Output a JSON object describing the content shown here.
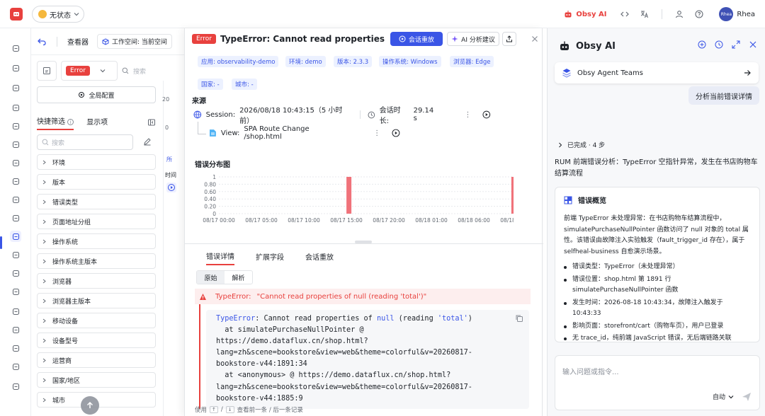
{
  "topbar": {
    "status_label": "无状态",
    "obsy_label": "Obsy AI",
    "user_avatar": "Rhea",
    "user_name": "Rhea"
  },
  "viewer": {
    "title": "查看器",
    "workspace": "工作空间: 当前空间",
    "filter_tag": "Error",
    "search_placeholder": "搜索",
    "global_config": "全局配置",
    "tab_quick_filter": "快捷筛选",
    "tab_display": "显示项",
    "facet_search_placeholder": "搜索",
    "facets": [
      "环境",
      "版本",
      "错误类型",
      "页面地址分组",
      "操作系统",
      "操作系统主版本",
      "浏览器",
      "浏览器主版本",
      "移动设备",
      "设备型号",
      "运营商",
      "国家/地区",
      "城市"
    ],
    "side_labels": [
      "20",
      "0",
      "所",
      "时间"
    ]
  },
  "detail": {
    "error_badge": "Error",
    "title": "TypeError: Cannot read properties of null...",
    "replay_button": "会话重放",
    "ai_button": "AI 分析建议",
    "tags": [
      "应用: observability-demo",
      "环境: demo",
      "版本: 2.3.3",
      "操作系统: Windows",
      "浏览器: Edge",
      "国家: -",
      "城市: -"
    ],
    "source_title": "来源",
    "session_label": "Session:",
    "session_time": "2026/08/18 10:43:15（5 小时前）",
    "duration_label": "会话时长:",
    "duration_value": "29.14 s",
    "view_label": "View:",
    "view_value": "SPA Route Change /shop.html",
    "dist_title": "错误分布图",
    "tabs": [
      "错误详情",
      "扩展字段",
      "会话重放"
    ],
    "toggle": [
      "原始",
      "解析"
    ],
    "error_type": "TypeError:",
    "error_message": "\"Cannot read properties of null (reading 'total')\"",
    "stack_lines": [
      "at simulatePurchaseNullPointer @",
      "https://demo.dataflux.cn/shop.html?",
      "lang=zh&scene=bookstore&view=web&theme=colorful&v=20260817-",
      "bookstore-v44:1891:34",
      "at <anonymous> @ https://demo.dataflux.cn/shop.html?",
      "lang=zh&scene=bookstore&view=web&theme=colorful&v=20260817-",
      "bookstore-v44:1885:9"
    ],
    "stack_head_kw": "TypeError",
    "stack_head_mid": ": Cannot read properties of ",
    "stack_head_null": "null",
    "stack_head_reading": " (reading ",
    "stack_head_total": "'total'",
    "stack_head_end": ")",
    "nav_hint_use": "使用",
    "nav_hint_up": "↑",
    "nav_hint_slash": "/",
    "nav_hint_down": "↓",
    "nav_hint_text": "查看前一条 / 后一条记录"
  },
  "chart_data": {
    "type": "bar",
    "title": "错误分布图",
    "x_tick_labels": [
      "08/17 00:00",
      "08/17 05:00",
      "08/17 10:00",
      "08/17 15:00",
      "08/17 20:00",
      "08/18 01:00",
      "08/18 06:00",
      "08/18 11:00"
    ],
    "y_tick_labels": [
      "1",
      "0.80",
      "0.60",
      "0.40",
      "0.20",
      "0"
    ],
    "ylim": [
      0,
      1
    ],
    "xlim_hours": [
      0,
      35
    ],
    "bars": [
      {
        "x": "08/17 15:00",
        "x_hours": 15.3,
        "value": 1
      },
      {
        "x": "08/18 10:43",
        "x_hours": 34.7,
        "value": 1
      }
    ],
    "bar_color": "#f0727a",
    "grid": true
  },
  "ai_panel": {
    "title": "Obsy AI",
    "agent_card": "Obsy Agent Teams",
    "user_message": "分析当前错误详情",
    "done_label": "已完成 · 4 步",
    "summary": "RUM 前端错误分析：TypeError 空指针异常，发生在书店购物车结算流程",
    "card_title": "错误概览",
    "card_paragraph": "前端 TypeError 未处理异常：在书店购物车结算流程中，simulatePurchaseNullPointer 函数访问了 null 对象的 total 属性。该错误由故障注入实验触发（fault_trigger_id 存在），属于 selfheal-business 自愈演示场景。",
    "bullets": [
      "错误类型：TypeError（未处理异常）",
      "错误位置：shop.html 第 1891 行 simulatePurchaseNullPointer 函数",
      "发生时间：2026-08-18 10:43:34，故障注入触发于 10:43:33",
      "影响页面：storefront/cart（购物车页），用户已登录",
      "无 trace_id，纯前端 JavaScript 错误，无后端链路关联"
    ],
    "input_placeholder": "输入问题或指令...",
    "mode": "自动"
  }
}
